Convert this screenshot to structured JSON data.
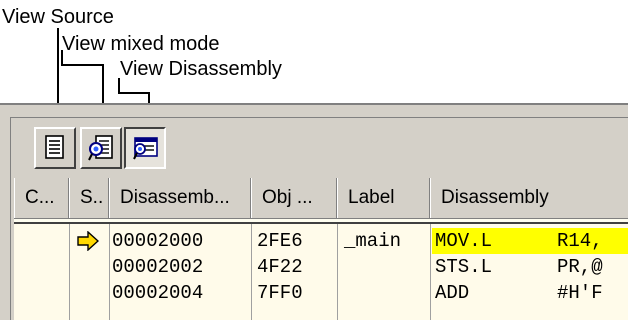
{
  "callouts": {
    "view_source": "View Source",
    "view_mixed_mode": "View mixed mode",
    "view_disassembly": "View Disassembly"
  },
  "toolbar": {
    "buttons": [
      {
        "name": "view-source",
        "icon": "source-document-icon",
        "pressed": false
      },
      {
        "name": "view-mixed-mode",
        "icon": "mixed-mode-icon",
        "pressed": false
      },
      {
        "name": "view-disassembly",
        "icon": "disassembly-icon",
        "pressed": true
      }
    ]
  },
  "table": {
    "columns": [
      "C...",
      "S..",
      "Disassemb...",
      "Obj ...",
      "Label",
      "Disassembly"
    ],
    "rows": [
      {
        "current": true,
        "address": "00002000",
        "object": "2FE6",
        "label": "_main",
        "mnemonic": "MOV.L",
        "operands": "R14,"
      },
      {
        "current": false,
        "address": "00002002",
        "object": "4F22",
        "label": "",
        "mnemonic": "STS.L",
        "operands": "PR,@"
      },
      {
        "current": false,
        "address": "00002004",
        "object": "7FF0",
        "label": "",
        "mnemonic": "ADD",
        "operands": "#H'F"
      }
    ]
  },
  "colors": {
    "highlight": "#ffff00",
    "pc_arrow": "#ffd800",
    "panel": "#d4d0c8",
    "grid_background": "#fffbea"
  }
}
